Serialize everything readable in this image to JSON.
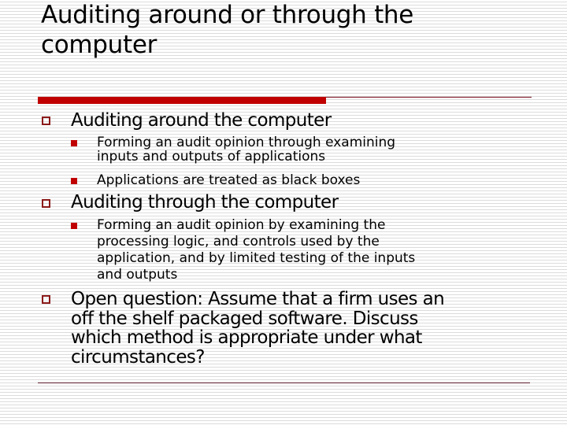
{
  "slide": {
    "title_line1": "Auditing around or through the",
    "title_line2": "computer",
    "accent_color": "#c00000",
    "bullets": [
      {
        "text": "Auditing around the computer",
        "sub": [
          {
            "line1": "Forming an audit opinion through examining",
            "line2": "inputs and outputs of applications"
          },
          {
            "line1": "Applications are treated as black boxes"
          }
        ]
      },
      {
        "text": "Auditing through the computer",
        "sub": [
          {
            "line1": "Forming an audit opinion by examining the",
            "line2": "processing logic, and controls used by the",
            "line3": "application, and by limited testing of the inputs",
            "line4": "and outputs"
          }
        ]
      },
      {
        "line1": "Open question: Assume that a firm uses an",
        "line2": "off the shelf packaged software. Discuss",
        "line3": "which method is appropriate under what",
        "line4": "circumstances?"
      }
    ]
  }
}
